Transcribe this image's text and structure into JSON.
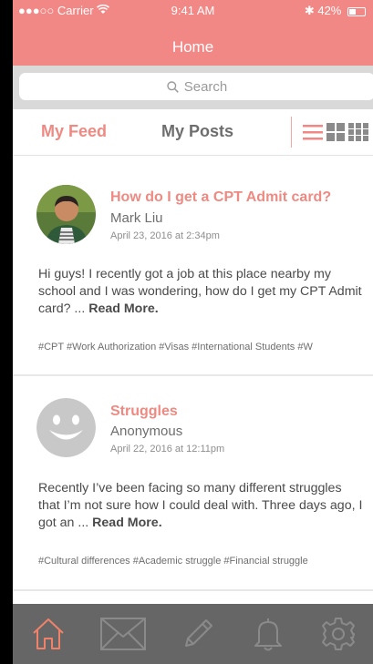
{
  "status_bar": {
    "carrier": "●●●○○ Carrier",
    "time": "9:41 AM",
    "battery": "42%"
  },
  "nav": {
    "title": "Home"
  },
  "search": {
    "placeholder": "Search"
  },
  "tabs": [
    {
      "label": "My Feed",
      "active": true
    },
    {
      "label": "My Posts",
      "active": false
    }
  ],
  "colors": {
    "accent": "#f28886",
    "tabbar": "#666666",
    "active_icon": "#f0826a"
  },
  "posts": [
    {
      "title": "How do I get a CPT Admit card?",
      "author": "Mark Liu",
      "date": "April 23, 2016 at 2:34pm",
      "body": "Hi guys! I recently got a job at this place nearby my school and I was wondering, how do I get my CPT Admit card? ...",
      "read_more": "Read More.",
      "tags": "#CPT #Work Authorization #Visas #International Students #W"
    },
    {
      "title": "Struggles",
      "author": "Anonymous",
      "date": "April 22, 2016 at 12:11pm",
      "body": "Recently I’ve been facing so many different struggles that I’m not sure how I could deal with. Three days ago, I got an ...",
      "read_more": "Read More.",
      "tags": "#Cultural differences #Academic struggle #Financial struggle"
    }
  ],
  "tabbar_icons": [
    "home-icon",
    "mail-icon",
    "pencil-icon",
    "bell-icon",
    "gear-icon"
  ]
}
